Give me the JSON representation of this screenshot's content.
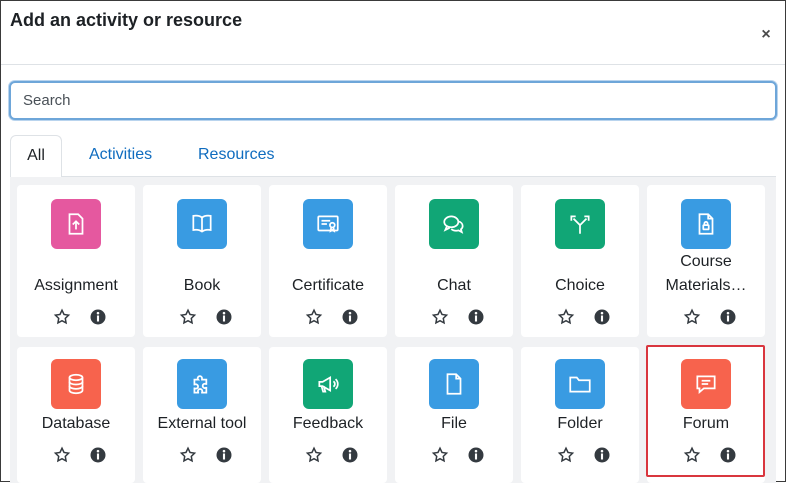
{
  "modal": {
    "title": "Add an activity or resource",
    "close_label": "×"
  },
  "search": {
    "placeholder": "Search",
    "value": ""
  },
  "tabs": [
    {
      "label": "All",
      "active": true
    },
    {
      "label": "Activities",
      "active": false
    },
    {
      "label": "Resources",
      "active": false
    }
  ],
  "items": [
    {
      "label": "Assignment",
      "icon": "assignment-icon",
      "color": "#e5589f"
    },
    {
      "label": "Book",
      "icon": "book-icon",
      "color": "#399be2"
    },
    {
      "label": "Certificate",
      "icon": "certificate-icon",
      "color": "#399be2"
    },
    {
      "label": "Chat",
      "icon": "chat-icon",
      "color": "#11a676"
    },
    {
      "label": "Choice",
      "icon": "choice-icon",
      "color": "#11a676"
    },
    {
      "label": "Course Materials…",
      "label_line1": "Course",
      "label_line2": "Materials…",
      "icon": "course-materials-icon",
      "color": "#399be2"
    },
    {
      "label": "Database",
      "icon": "database-icon",
      "color": "#f7634d"
    },
    {
      "label": "External tool",
      "icon": "external-tool-icon",
      "color": "#399be2"
    },
    {
      "label": "Feedback",
      "icon": "feedback-icon",
      "color": "#11a676"
    },
    {
      "label": "File",
      "icon": "file-icon",
      "color": "#399be2"
    },
    {
      "label": "Folder",
      "icon": "folder-icon",
      "color": "#399be2"
    },
    {
      "label": "Forum",
      "icon": "forum-icon",
      "color": "#f7634d"
    }
  ],
  "colors": {
    "link": "#0f6cbf",
    "highlight": "#d9363e",
    "search_focus": "#6ea6d9"
  }
}
